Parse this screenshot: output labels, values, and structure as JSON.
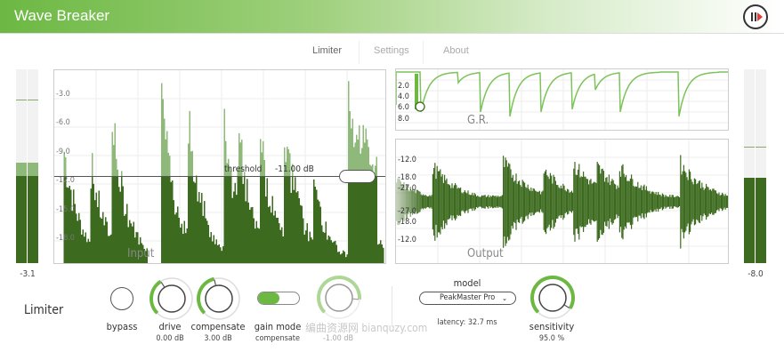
{
  "app": {
    "title": "Wave Breaker",
    "logo_icon": "pause-play-logo-icon"
  },
  "tabs": [
    {
      "label": "Limiter",
      "active": true
    },
    {
      "label": "Settings",
      "active": false
    },
    {
      "label": "About",
      "active": false
    }
  ],
  "colors": {
    "accent": "#6cb843",
    "wave": "#3c6a1e",
    "wave_light": "#8fb97a",
    "gr_line": "#7cc35a"
  },
  "input_meter": {
    "value": "-3.1"
  },
  "output_meter": {
    "value": "-8.0"
  },
  "input_graph": {
    "label": "Input",
    "ticks": [
      "-3.0",
      "-6.0",
      "-9.0",
      "-12.0",
      "-15.0",
      "-18.0"
    ],
    "threshold_label": "threshold",
    "threshold_value": "-11.00 dB"
  },
  "gr_graph": {
    "label": "G.R.",
    "ticks": [
      "2.0",
      "4.0",
      "6.0",
      "8.0"
    ]
  },
  "output_graph": {
    "label": "Output",
    "ticks": [
      "-12.0",
      "-18.0",
      "-27.0",
      "-27.0",
      "-18.0",
      "-12.0"
    ]
  },
  "controls": {
    "section_title": "Limiter",
    "bypass": {
      "label": "bypass"
    },
    "drive": {
      "label": "drive",
      "value": "0.00 dB",
      "fraction": 0.38
    },
    "compensate": {
      "label": "compensate",
      "value": "3.00 dB",
      "fraction": 0.45
    },
    "gain_mode": {
      "label": "gain mode",
      "value": "compensate"
    },
    "output_gain": {
      "value": "-1.00 dB",
      "fraction": 0.85
    },
    "model": {
      "label": "model",
      "selected": "PeakMaster Pro",
      "latency": "latency: 32.7 ms"
    },
    "sensitivity": {
      "label": "sensitivity",
      "value": "95.0 %",
      "fraction": 0.95
    }
  },
  "watermark": "编曲资源网 bianquzy.com"
}
